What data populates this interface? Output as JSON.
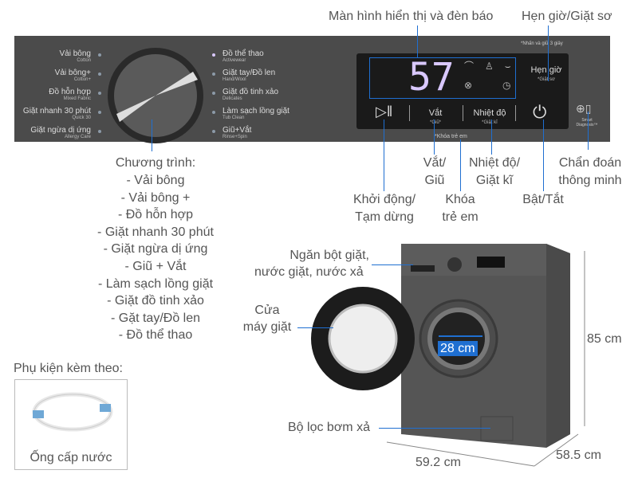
{
  "panel": {
    "programs_left": [
      {
        "vi": "Vải bông",
        "en": "Cotton"
      },
      {
        "vi": "Vải bông+",
        "en": "Cotton+"
      },
      {
        "vi": "Đồ hỗn hợp",
        "en": "Mixed Fabric"
      },
      {
        "vi": "Giặt nhanh 30 phút",
        "en": "Quick 30"
      },
      {
        "vi": "Giặt ngừa dị ứng",
        "en": "Allergy Care"
      }
    ],
    "programs_right": [
      {
        "vi": "Đồ thể thao",
        "en": "Activewear"
      },
      {
        "vi": "Giặt tay/Đồ len",
        "en": "Hand/Wool"
      },
      {
        "vi": "Giặt đồ tinh xảo",
        "en": "Delicates"
      },
      {
        "vi": "Làm sạch lồng giặt",
        "en": "Tub Clean"
      },
      {
        "vi": "Giũ+Vắt",
        "en": "Rinse+Spin"
      }
    ],
    "display_digits": "57",
    "hold_note": "*Nhấn và giữ 3 giây",
    "timer_btn": "Hẹn giờ",
    "timer_sub": "*Giặt sơ",
    "spin_btn": "Vắt",
    "spin_sub": "*Giũ*",
    "temp_btn": "Nhiệt độ",
    "temp_sub": "*Giặt kĩ",
    "child_lock": "*Khóa trẻ em",
    "smart_diag": "Smart Diagnosis™",
    "accent": "#1f6fd1",
    "digit_color": "#d9c8ff"
  },
  "callouts": {
    "display": "Màn hình hiển thị và đèn báo",
    "timer": "Hẹn giờ/Giặt sơ",
    "programs_title": "Chương trình:",
    "programs_list": [
      "- Vải bông",
      "- Vải bông +",
      "- Đồ hỗn hợp",
      "- Giặt nhanh 30 phút",
      "- Giặt ngừa dị ứng",
      "- Giũ + Vắt",
      "- Làm sạch lồng giặt",
      "- Giặt đồ tinh xảo",
      "- Gặt tay/Đồ len",
      "- Đồ thể thao"
    ],
    "spin": [
      "Vắt/",
      "Giũ"
    ],
    "temp": [
      "Nhiệt độ/",
      "Giặt kĩ"
    ],
    "smart": [
      "Chẩn đoán",
      "thông minh"
    ],
    "start": [
      "Khởi động/",
      "Tạm dừng"
    ],
    "lock": [
      "Khóa",
      "trẻ em"
    ],
    "power": "Bật/Tắt",
    "drawer": [
      "Ngăn bột giặt,",
      "nước giặt, nước xả"
    ],
    "door": [
      "Cửa",
      "máy giặt"
    ],
    "filter": "Bộ lọc bơm xả",
    "drum": "28 cm",
    "height": "85 cm",
    "width": "59.2 cm",
    "depth": "58.5 cm"
  },
  "accessories": {
    "title": "Phụ kiện kèm theo:",
    "item": "Ống cấp nước"
  }
}
